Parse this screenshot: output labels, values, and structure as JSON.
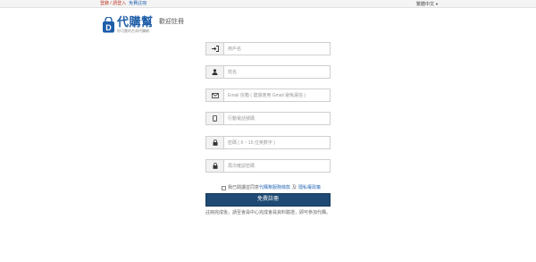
{
  "topbar": {
    "login_label": "登錄 / 請登入",
    "register_label": "免費註冊",
    "language_label": "繁體中文"
  },
  "logo": {
    "name": "代購幫",
    "tagline": "你可靠的台灣代購網"
  },
  "page": {
    "title": "歡迎註冊"
  },
  "form": {
    "username_placeholder": "用戶名",
    "name_placeholder": "姓名",
    "email_placeholder": "Email 信箱 ( 建議使用 Gmail 避免漏信 )",
    "phone_placeholder": "行動電話號碼",
    "password_placeholder": "密碼 ( 6 ~ 15 位英數字 )",
    "confirm_placeholder": "再次確認密碼",
    "terms_prefix": "我已閱讀並同意",
    "terms_link1": "代購幫服務條款",
    "terms_and": "及",
    "terms_link2": "隱私權政策",
    "submit_label": "免費註冊",
    "after_note": "註冊完成後，請至會員中心完成會員資料驗證，即可參加代購。"
  },
  "colors": {
    "brand": "#1d5ea8",
    "button": "#1e4a74",
    "link_red": "#c0392b"
  }
}
